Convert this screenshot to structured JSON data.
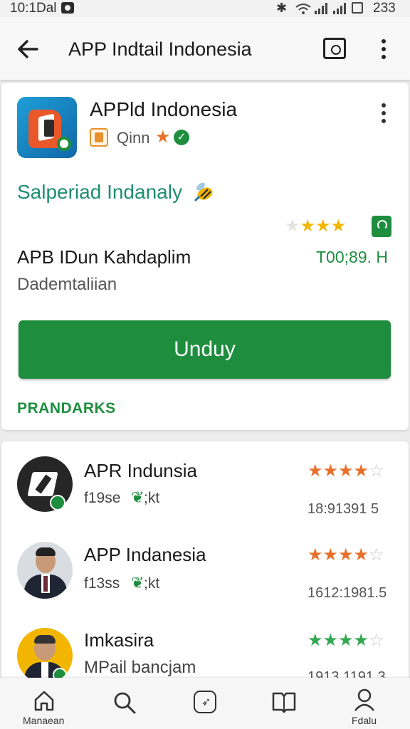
{
  "status_bar": {
    "time": "10:1Dal",
    "battery": "233"
  },
  "app_bar": {
    "title": "APP Indtail Indonesia"
  },
  "app": {
    "name": "APPld Indonesia",
    "developer": "Qinn",
    "tagline": "Salperiad Indanaly",
    "subtitle": "APB IDun Kahdaplim",
    "category": "Dademtaliian",
    "rating_stars": 3,
    "downloads": "T00;89. H",
    "install_label": "Unduy",
    "section_link": "PRANDARKS"
  },
  "related": [
    {
      "name": "APR Indunsia",
      "meta": "f19se",
      "meta_tail": ";kt",
      "count": "18:91391 5",
      "rating_stars": 4,
      "star_color": "#e8702a"
    },
    {
      "name": "APP Indanesia",
      "meta": "f13ss",
      "meta_tail": ";kt",
      "count": "1612:1981.5",
      "rating_stars": 4,
      "star_color": "#e8702a"
    },
    {
      "name": "Imkasira",
      "meta": "MPail bancjam",
      "meta_tail": "",
      "count": "1913 1191.3",
      "rating_stars": 4,
      "star_color": "#34a853"
    }
  ],
  "bottom_nav": [
    {
      "label": "Manaean",
      "icon": "home-icon"
    },
    {
      "label": "",
      "icon": "search-icon"
    },
    {
      "label": "",
      "icon": "compass-icon"
    },
    {
      "label": "",
      "icon": "book-icon"
    },
    {
      "label": "Fdalu",
      "icon": "profile-icon"
    }
  ],
  "colors": {
    "accent": "#1e8e3e",
    "star_gold": "#f2b600",
    "star_orange": "#e8702a",
    "star_green": "#34a853"
  }
}
